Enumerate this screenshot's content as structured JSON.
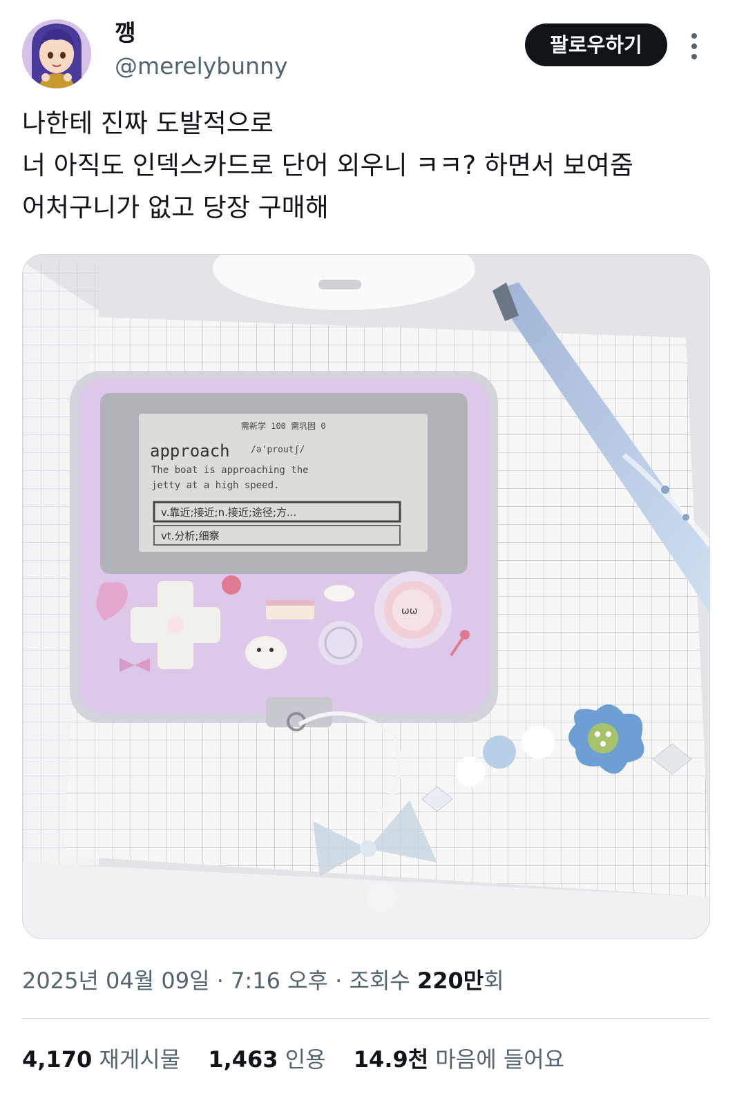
{
  "author": {
    "display_name": "깽",
    "handle": "@merelybunny",
    "avatar_icon": "anime-girl-avatar"
  },
  "header": {
    "follow_label": "팔로우하기",
    "more_icon": "more-vertical-icon"
  },
  "tweet": {
    "lines": [
      "나한테 진짜 도발적으로",
      "너 아직도 인덱스카드로 단어 외우니 ㅋㅋ? 하면서 보여줌",
      "어처구니가 없고 당장 구매해"
    ]
  },
  "media": {
    "screen": {
      "status": "需新学 100  需巩固  0",
      "word": "approach",
      "phonetic": "/ə'proutʃ/",
      "example_lines": [
        "The boat is approaching the",
        "jetty at a high speed."
      ],
      "options": [
        "v.靠近;接近;n.接近;途径;方...",
        "vt.分析;细察"
      ]
    }
  },
  "meta": {
    "date": "2025년 04월 09일",
    "separator": "·",
    "time": "7:16 오후",
    "views_label": "조회수",
    "views_number": "220만",
    "views_suffix": "회"
  },
  "stats": {
    "retweets": {
      "count": "4,170",
      "label": "재게시물"
    },
    "quotes": {
      "count": "1,463",
      "label": "인용"
    },
    "likes": {
      "count": "14.9천",
      "label": "마음에 들어요"
    }
  },
  "colors": {
    "text_primary": "#0f1419",
    "text_secondary": "#536471",
    "button_bg": "#0f1419",
    "divider": "#cfd9de",
    "device_lavender": "#dcc9ea"
  }
}
